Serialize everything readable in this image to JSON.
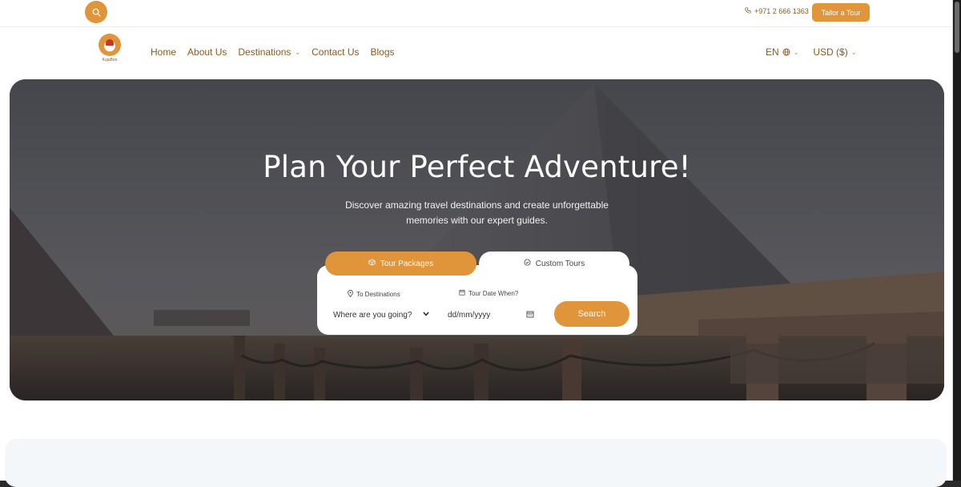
{
  "topbar": {
    "search_icon": "search-icon",
    "phone_icon": "phone-icon",
    "phone": "+971 2 666 1363",
    "tailor_label": "Tailor a Tour"
  },
  "nav": {
    "logo_text": "KujuBoo",
    "items": [
      {
        "label": "Home"
      },
      {
        "label": "About Us"
      },
      {
        "label": "Destinations",
        "has_dropdown": true
      },
      {
        "label": "Contact Us"
      },
      {
        "label": "Blogs"
      }
    ],
    "language": "EN",
    "language_icon": "globe-icon",
    "currency": "USD ($)"
  },
  "hero": {
    "title": "Plan Your Perfect Adventure!",
    "subtitle": "Discover amazing travel destinations and create unforgettable memories with our expert guides."
  },
  "search": {
    "tabs": [
      {
        "label": "Tour Packages",
        "icon": "package-icon",
        "active": true
      },
      {
        "label": "Custom Tours",
        "icon": "check-circle-icon",
        "active": false
      }
    ],
    "destination_label": "To Destinations",
    "destination_icon": "location-pin-icon",
    "destination_value": "Where are you going?",
    "date_label": "Tour Date When?",
    "date_icon": "calendar-icon",
    "date_placeholder": "dd/mm/yyyy",
    "button_label": "Search"
  },
  "colors": {
    "accent": "#e0953a",
    "nav_text": "#8a5a1e"
  }
}
